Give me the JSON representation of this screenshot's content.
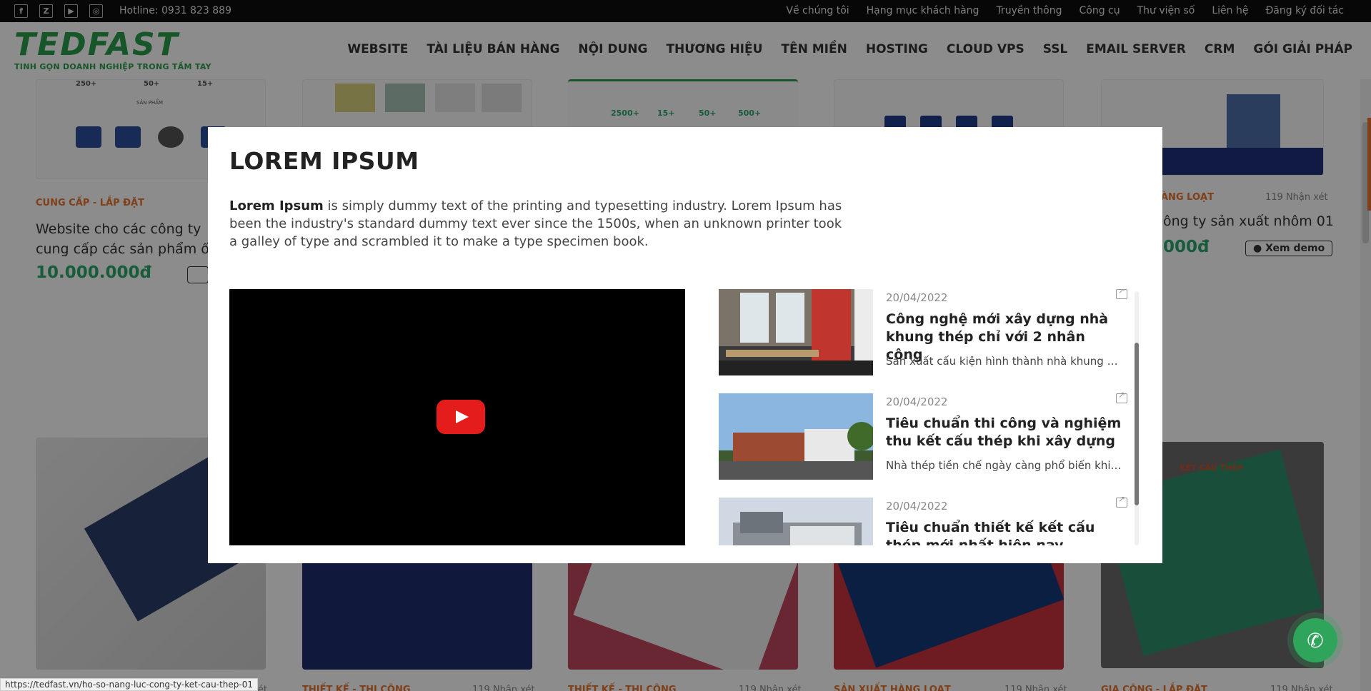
{
  "topbar": {
    "social_icons": [
      "facebook-icon",
      "zalo-icon",
      "youtube-icon",
      "instagram-icon"
    ],
    "hotline": "Hotline: 0931 823 889",
    "links": [
      "Về chúng tôi",
      "Hạng mục khách hàng",
      "Truyền thông",
      "Công cụ",
      "Thư viện số",
      "Liên hệ",
      "Đăng ký đối tác"
    ]
  },
  "header": {
    "logo_text": "TEDFAST",
    "logo_tagline": "TINH GỌN DOANH NGHIỆP TRONG TẦM TAY",
    "nav": [
      "WEBSITE",
      "TÀI LIỆU BÁN HÀNG",
      "NỘI DUNG",
      "THƯƠNG HIỆU",
      "TÊN MIỀN",
      "HOSTING",
      "CLOUD VPS",
      "SSL",
      "EMAIL SERVER",
      "CRM",
      "GÓI GIẢI PHÁP"
    ]
  },
  "background": {
    "card1": {
      "category": "CUNG CẤP - LẮP ĐẶT",
      "title": "Website cho các công ty cung cấp các sản phẩm ốn",
      "price": "10.000.000đ",
      "stats": [
        "250+",
        "50+",
        "15+"
      ],
      "section_label": "SẢN PHẨM"
    },
    "card3": {
      "stats": [
        "2500+",
        "15+",
        "50+",
        "500+"
      ]
    },
    "card5": {
      "category_partial": "ÀNG LOẠT",
      "reviews": "119 Nhận xét",
      "title_partial": "ông ty sản xuất nhôm 01",
      "price_partial": "000đ",
      "demo_label": "Xem demo"
    },
    "row2": [
      {
        "category": "THIẾT KẾ - THI CÔNG",
        "reviews": "119 Nhận xét"
      },
      {
        "category": "THIẾT KẾ - THI CÔNG",
        "reviews": "119 Nhận xét"
      },
      {
        "category": "SẢN XUẤT HÀNG LOẠT",
        "reviews": "119 Nhận xét"
      },
      {
        "category": "GIA CÔNG - LẮP ĐẶT",
        "reviews": "119 Nhận xét"
      }
    ],
    "row2_first_reviews_partial": "hận xét",
    "brochure_title": "KẾT CẤU THÉP"
  },
  "modal": {
    "title": "LOREM IPSUM",
    "intro_bold": "Lorem Ipsum",
    "intro_rest": " is simply dummy text of the printing and typesetting industry. Lorem Ipsum has been the industry's standard dummy text ever since the 1500s, when an unknown printer took a galley of type and scrambled it to make a type specimen book.",
    "video_icon": "youtube-play-icon",
    "news": [
      {
        "date": "20/04/2022",
        "title": "Công nghệ mới xây dựng nhà khung thép chỉ với 2 nhân công",
        "excerpt": "Sản xuất cấu kiện hình thành nhà khung thép"
      },
      {
        "date": "20/04/2022",
        "title": "Tiêu chuẩn thi công và nghiệm thu kết cấu thép khi xây dựng nhà tiền chế",
        "excerpt": "Nhà thép tiền chế ngày càng phổ biến khi xây dựng"
      },
      {
        "date": "20/04/2022",
        "title": "Tiêu chuẩn thiết kế kết cấu thép mới nhất hiện nay",
        "excerpt": ""
      }
    ]
  },
  "status_url": "https://tedfast.vn/ho-so-nang-luc-cong-ty-ket-cau-thep-01",
  "colors": {
    "accent_orange": "#e8742c",
    "brand_green": "#2a9d4a",
    "price_green": "#2aa86c",
    "youtube_red": "#e51c1c"
  }
}
